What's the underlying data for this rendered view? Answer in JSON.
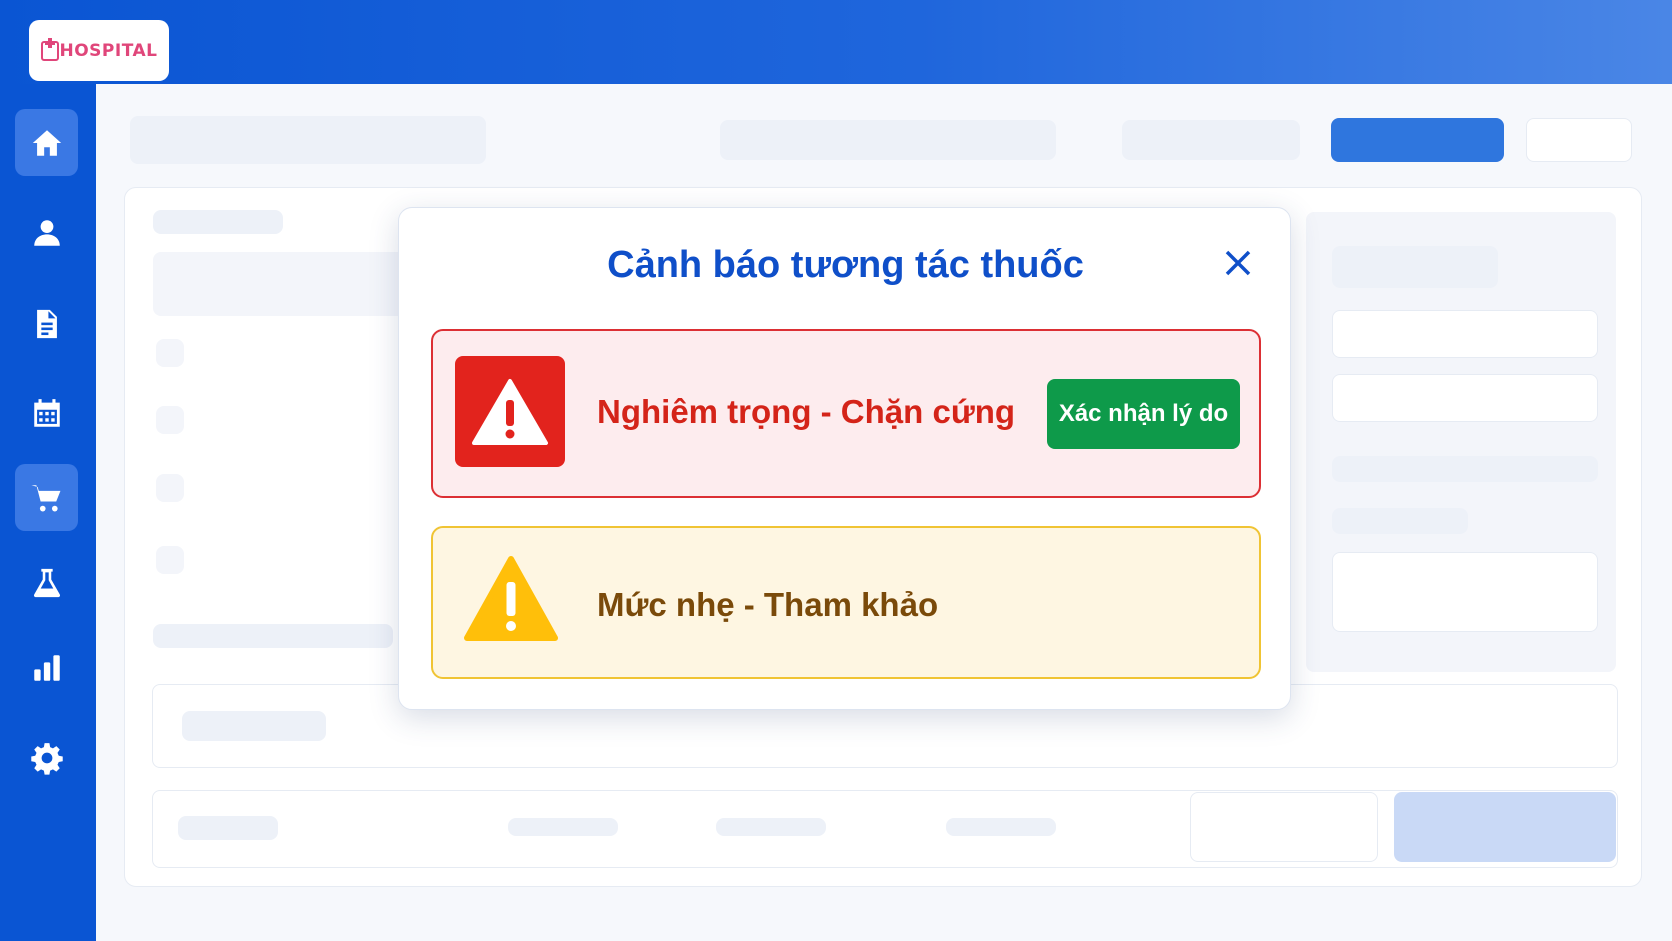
{
  "app": {
    "logo_text": "HOSPITAL"
  },
  "sidebar": {
    "items": [
      {
        "icon": "home-icon"
      },
      {
        "icon": "user-icon"
      },
      {
        "icon": "document-icon"
      },
      {
        "icon": "calendar-icon"
      },
      {
        "icon": "cart-icon",
        "active": true
      },
      {
        "icon": "flask-icon"
      },
      {
        "icon": "bar-chart-icon"
      },
      {
        "icon": "gear-icon"
      }
    ]
  },
  "dialog": {
    "title": "Cảnh báo tương tác thuốc",
    "close_icon": "close-icon",
    "severe": {
      "label": "Nghiêm trọng - Chặn cứng",
      "button_label": "Xác nhận lý do",
      "icon": "warning-triangle-icon",
      "color": "#dc2f34"
    },
    "mild": {
      "label": "Mức nhẹ - Tham khảo",
      "icon": "warning-triangle-icon",
      "color": "#f0c434"
    }
  },
  "colors": {
    "primary": "#0a55d3",
    "success": "#0e9a4a",
    "danger": "#e2231d",
    "warning": "#ffc107"
  }
}
